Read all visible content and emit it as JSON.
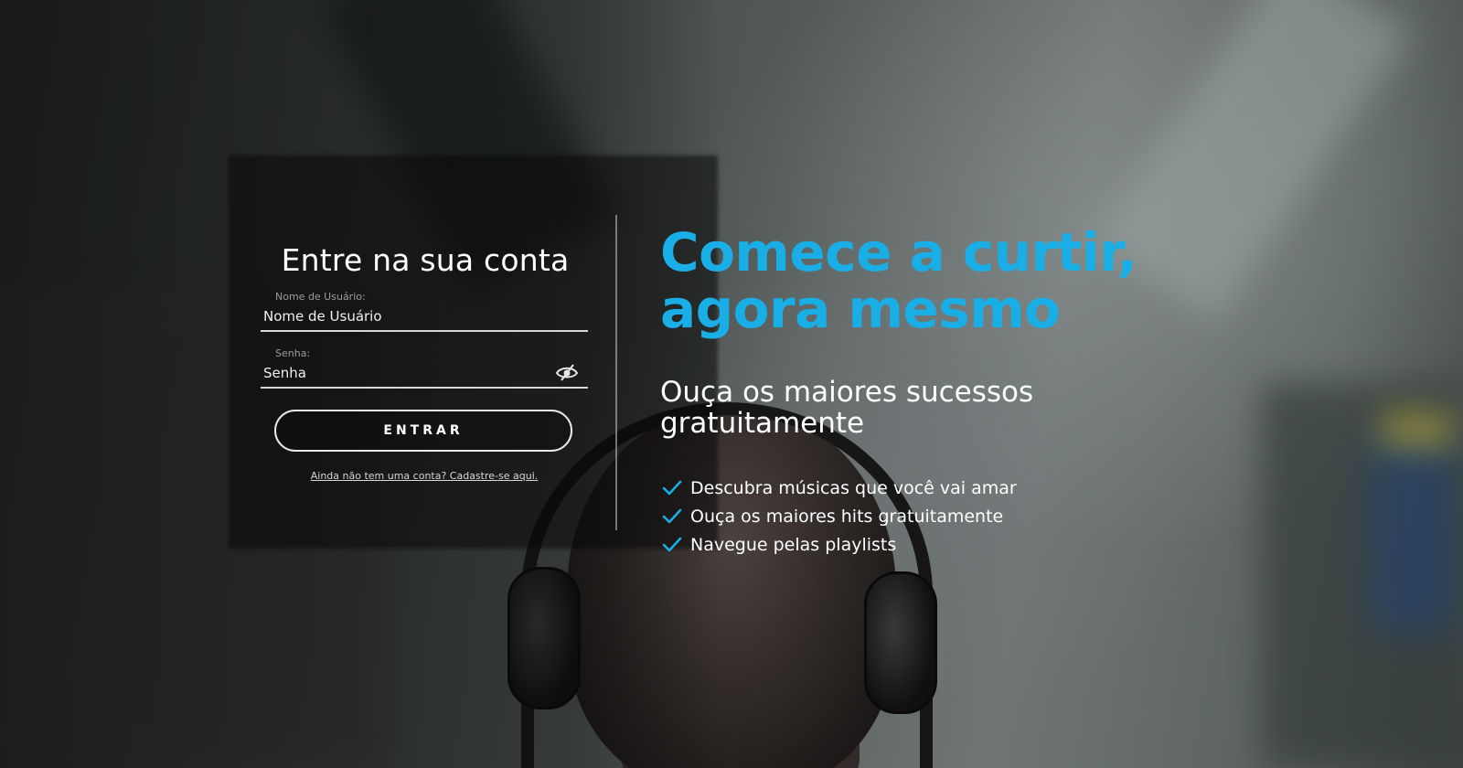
{
  "colors": {
    "accent": "#1aaee6",
    "text": "#ffffff",
    "label": "#9c9c9c",
    "check": "#1aaee6"
  },
  "login": {
    "title": "Entre na sua conta",
    "username": {
      "label": "Nome de Usuário:",
      "placeholder": "Nome de Usuário",
      "value": ""
    },
    "password": {
      "label": "Senha:",
      "placeholder": "Senha",
      "value": "",
      "toggle_icon": "eye-slash-icon"
    },
    "submit_label": "ENTRAR",
    "signup_text": "Ainda não tem uma conta? Cadastre-se aqui."
  },
  "hero": {
    "title_line1": "Comece a curtir,",
    "title_line2": "agora mesmo",
    "subtitle_line1": "Ouça os maiores sucessos",
    "subtitle_line2": "gratuitamente",
    "features": [
      {
        "icon": "check-icon",
        "text": "Descubra músicas que você vai amar"
      },
      {
        "icon": "check-icon",
        "text": "Ouça os maiores hits gratuitamente"
      },
      {
        "icon": "check-icon",
        "text": "Navegue pelas playlists"
      }
    ]
  }
}
